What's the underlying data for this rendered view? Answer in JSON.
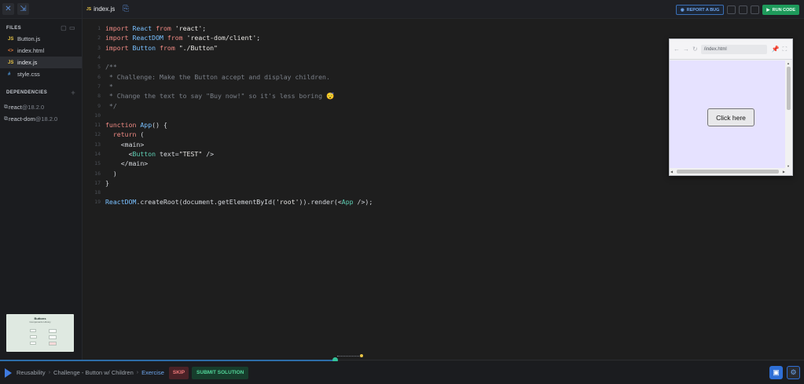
{
  "sidebar": {
    "files_title": "FILES",
    "files": [
      {
        "icon": "JS",
        "icon_type": "js",
        "name": "Button.js",
        "active": false
      },
      {
        "icon": "<>",
        "icon_type": "html",
        "name": "index.html",
        "active": false
      },
      {
        "icon": "JS",
        "icon_type": "js",
        "name": "index.js",
        "active": true
      },
      {
        "icon": "#",
        "icon_type": "css",
        "name": "style.css",
        "active": false
      }
    ],
    "deps_title": "DEPENDENCIES",
    "deps_plus": "+",
    "dependencies": [
      {
        "name": "react",
        "version": "@18.2.0"
      },
      {
        "name": "react-dom",
        "version": "@18.2.0"
      }
    ],
    "thumbnail": {
      "title": "Buttons",
      "subtitle": "Components Library"
    }
  },
  "tabbar": {
    "active_tab": "index.js",
    "active_tab_icon": "JS",
    "report_label": "REPORT A BUG",
    "run_label": "RUN CODE"
  },
  "code_lines": [
    "import React from 'react';",
    "import ReactDOM from 'react-dom/client';",
    "import Button from \"./Button\"",
    "",
    "/**",
    " * Challenge: Make the Button accept and display children.",
    " *",
    " * Change the text to say \"Buy now!\" so it's less boring 😴",
    " */",
    "",
    "function App() {",
    "  return (",
    "    <main>",
    "      <Button text=\"TEST\" />",
    "    </main>",
    "  )",
    "}",
    "",
    "ReactDOM.createRoot(document.getElementById('root')).render(<App />);"
  ],
  "preview": {
    "url": "/index.html",
    "button_label": "Click here"
  },
  "bottom_bar": {
    "course": "Reusability",
    "lesson": "Challenge - Button w/ Children",
    "type": "Exercise",
    "skip_label": "SKIP",
    "submit_label": "SUBMIT SOLUTION"
  },
  "colors": {
    "accent_blue": "#3f7be0",
    "run_green": "#1e9a5b",
    "skip_red": "#f07a7a",
    "preview_bg": "#e6e2ff"
  }
}
